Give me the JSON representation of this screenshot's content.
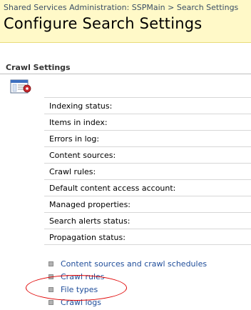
{
  "header": {
    "breadcrumb": [
      {
        "label": "Shared Services Administration: SSPMain"
      },
      {
        "label": "Search Settings"
      }
    ],
    "breadcrumb_separator": ">",
    "title": "Configure Search Settings"
  },
  "crawl_settings": {
    "section_title": "Crawl Settings",
    "icon": "settings-window-icon",
    "status_rows": [
      {
        "label": "Indexing status:"
      },
      {
        "label": "Items in index:"
      },
      {
        "label": "Errors in log:"
      },
      {
        "label": "Content sources:"
      },
      {
        "label": "Crawl rules:"
      },
      {
        "label": "Default content access account:"
      },
      {
        "label": "Managed properties:"
      },
      {
        "label": "Search alerts status:"
      },
      {
        "label": "Propagation status:"
      }
    ],
    "links": [
      {
        "label": "Content sources and crawl schedules"
      },
      {
        "label": "Crawl rules"
      },
      {
        "label": "File types"
      },
      {
        "label": "Crawl logs"
      }
    ]
  },
  "colors": {
    "header_background": "#fff9c8",
    "link": "#1f4d9a",
    "annotation": "#e00000"
  }
}
